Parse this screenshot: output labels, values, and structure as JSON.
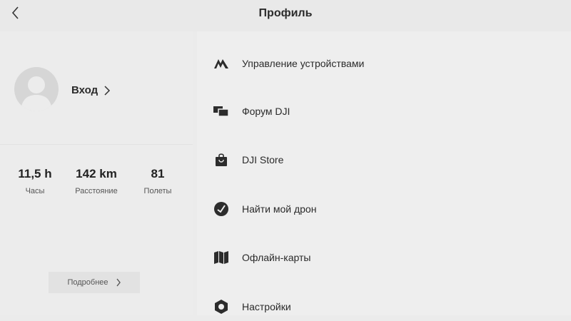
{
  "header": {
    "title": "Профиль",
    "back_icon": "chevron-left-icon"
  },
  "profile": {
    "login_label": "Вход",
    "avatar_icon": "user-avatar-icon",
    "stats": [
      {
        "value": "11,5 h",
        "label": "Часы"
      },
      {
        "value": "142 km",
        "label": "Расстояние"
      },
      {
        "value": "81",
        "label": "Полеты"
      }
    ],
    "more_label": "Подробнее"
  },
  "menu": {
    "items": [
      {
        "label": "Управление устройствами",
        "icon": "device-management-icon"
      },
      {
        "label": "Форум DJI",
        "icon": "forum-icon"
      },
      {
        "label": "DJI Store",
        "icon": "shopping-bag-icon"
      },
      {
        "label": "Найти мой дрон",
        "icon": "find-drone-icon"
      },
      {
        "label": "Офлайн-карты",
        "icon": "map-icon"
      },
      {
        "label": "Настройки",
        "icon": "settings-icon"
      }
    ]
  },
  "colors": {
    "background": "#ebebeb",
    "text": "#2a2a2a",
    "icon": "#2c2c2c"
  }
}
